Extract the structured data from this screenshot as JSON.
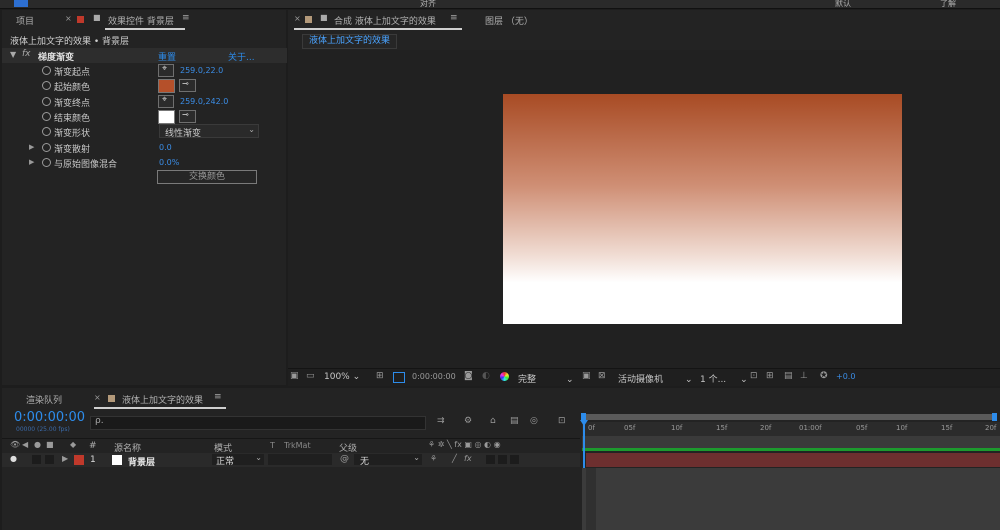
{
  "toolbar": {
    "items": [
      "对齐",
      "默认",
      "了解"
    ]
  },
  "project_tab": "项目",
  "effect_controls": {
    "tab_prefix": "效果控件",
    "tab_layer": "背景层",
    "title": "液体上加文字的效果 • 背景层",
    "effect_name": "梯度渐变",
    "reset": "重置",
    "about": "关于...",
    "rows": [
      {
        "label": "渐变起点",
        "value": "259.0,22.0"
      },
      {
        "label": "起始颜色",
        "color": "#b5502a"
      },
      {
        "label": "渐变终点",
        "value": "259.0,242.0"
      },
      {
        "label": "结束颜色",
        "color": "#ffffff"
      },
      {
        "label": "渐变形状",
        "value": "线性渐变"
      },
      {
        "label": "渐变散射",
        "value": "0.0"
      },
      {
        "label": "与原始图像混合",
        "value": "0.0%"
      }
    ],
    "swap_button": "交换颜色"
  },
  "composition": {
    "tab_prefix": "合成",
    "tab_name": "液体上加文字的效果",
    "layer_tab": "图层 （无）",
    "sub_tab": "液体上加文字的效果",
    "gradient_top": "#a84b24",
    "gradient_bottom": "#ffffff",
    "zoom": "100%",
    "timecode": "0:00:00:00",
    "resolution": "完整",
    "camera": "活动摄像机",
    "views": "1 个...",
    "exposure": "+0.0"
  },
  "timeline": {
    "render_tab": "渲染队列",
    "comp_tab": "液体上加文字的效果",
    "timecode": "0:00:00:00",
    "timecode_sub": "00000 (25.00 fps)",
    "search_placeholder": "ρ.",
    "columns": {
      "num": "#",
      "source": "源名称",
      "mode": "模式",
      "t": "T",
      "trkmat": "TrkMat",
      "parent": "父级"
    },
    "layer": {
      "num": "1",
      "name": "背景层",
      "mode": "正常",
      "parent": "无",
      "color": "#c0392b"
    },
    "ruler": [
      "0f",
      "05f",
      "10f",
      "15f",
      "20f",
      "01:00f",
      "05f",
      "10f",
      "15f",
      "20f"
    ]
  }
}
